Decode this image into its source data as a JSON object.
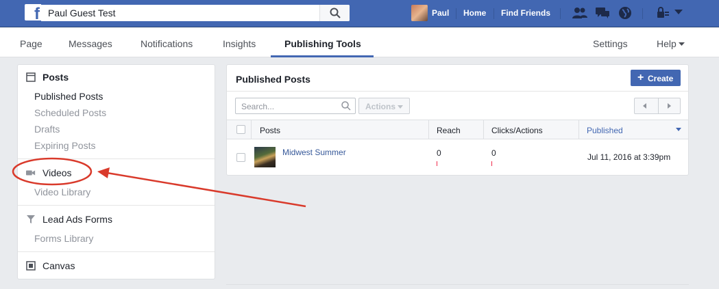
{
  "topbar": {
    "search_value": "Paul Guest Test",
    "user_name": "Paul",
    "home_label": "Home",
    "find_friends_label": "Find Friends",
    "icons": [
      "facebook-logo-icon",
      "search-icon",
      "friend-requests-icon",
      "messages-icon",
      "notifications-globe-icon",
      "privacy-lock-icon",
      "account-menu-caret-icon"
    ]
  },
  "tabs": {
    "page": "Page",
    "messages": "Messages",
    "notifications": "Notifications",
    "insights": "Insights",
    "publishing_tools": "Publishing Tools",
    "settings": "Settings",
    "help": "Help"
  },
  "sidebar": {
    "posts": {
      "title": "Posts",
      "items": [
        "Published Posts",
        "Scheduled Posts",
        "Drafts",
        "Expiring Posts"
      ]
    },
    "videos": {
      "title": "Videos",
      "items": [
        "Video Library"
      ]
    },
    "lead_ads": {
      "title": "Lead Ads Forms",
      "items": [
        "Forms Library"
      ]
    },
    "canvas": {
      "title": "Canvas"
    }
  },
  "main": {
    "title": "Published Posts",
    "create_label": "Create",
    "search_placeholder": "Search...",
    "actions_label": "Actions",
    "columns": [
      "Posts",
      "Reach",
      "Clicks/Actions",
      "Published"
    ],
    "rows": [
      {
        "title": "Midwest Summer",
        "reach": "0",
        "clicks": "0",
        "published": "Jul 11, 2016 at 3:39pm"
      }
    ]
  },
  "colors": {
    "brand": "#4267b2",
    "annotation": "#d93a2b"
  }
}
